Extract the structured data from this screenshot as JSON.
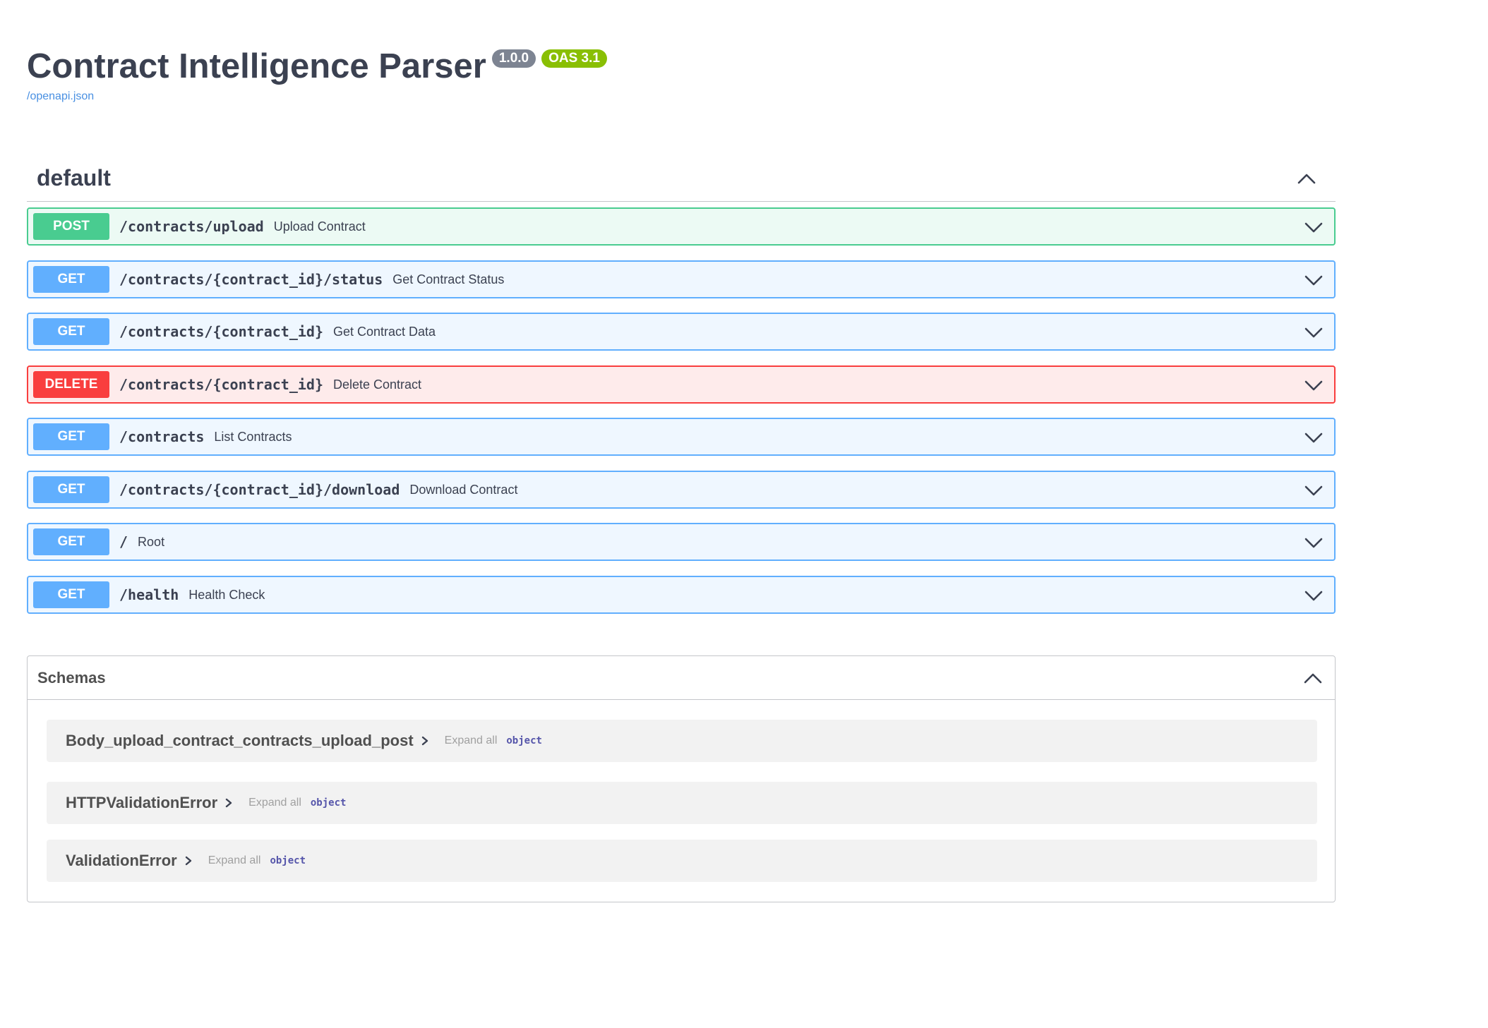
{
  "info": {
    "title": "Contract Intelligence Parser",
    "version": "1.0.0",
    "oas_version": "OAS 3.1",
    "spec_link": "/openapi.json"
  },
  "tag": {
    "name": "default",
    "toggle_icon": "chevron-up-icon"
  },
  "colors": {
    "post": "#49cc90",
    "get": "#61affe",
    "delete": "#f93e3e",
    "version_badge": "#7d8492",
    "oas_badge": "#89bf04",
    "link": "#4990e2"
  },
  "operations": [
    {
      "method": "POST",
      "path": "/contracts/upload",
      "summary": "Upload Contract"
    },
    {
      "method": "GET",
      "path": "/contracts/{contract_id}/status",
      "summary": "Get Contract Status"
    },
    {
      "method": "GET",
      "path": "/contracts/{contract_id}",
      "summary": "Get Contract Data"
    },
    {
      "method": "DELETE",
      "path": "/contracts/{contract_id}",
      "summary": "Delete Contract"
    },
    {
      "method": "GET",
      "path": "/contracts",
      "summary": "List Contracts"
    },
    {
      "method": "GET",
      "path": "/contracts/{contract_id}/download",
      "summary": "Download Contract"
    },
    {
      "method": "GET",
      "path": "/",
      "summary": "Root"
    },
    {
      "method": "GET",
      "path": "/health",
      "summary": "Health Check"
    }
  ],
  "schemas": {
    "title": "Schemas",
    "items": [
      {
        "name": "Body_upload_contract_contracts_upload_post",
        "expand_label": "Expand all",
        "type": "object"
      },
      {
        "name": "HTTPValidationError",
        "expand_label": "Expand all",
        "type": "object"
      },
      {
        "name": "ValidationError",
        "expand_label": "Expand all",
        "type": "object"
      }
    ]
  }
}
